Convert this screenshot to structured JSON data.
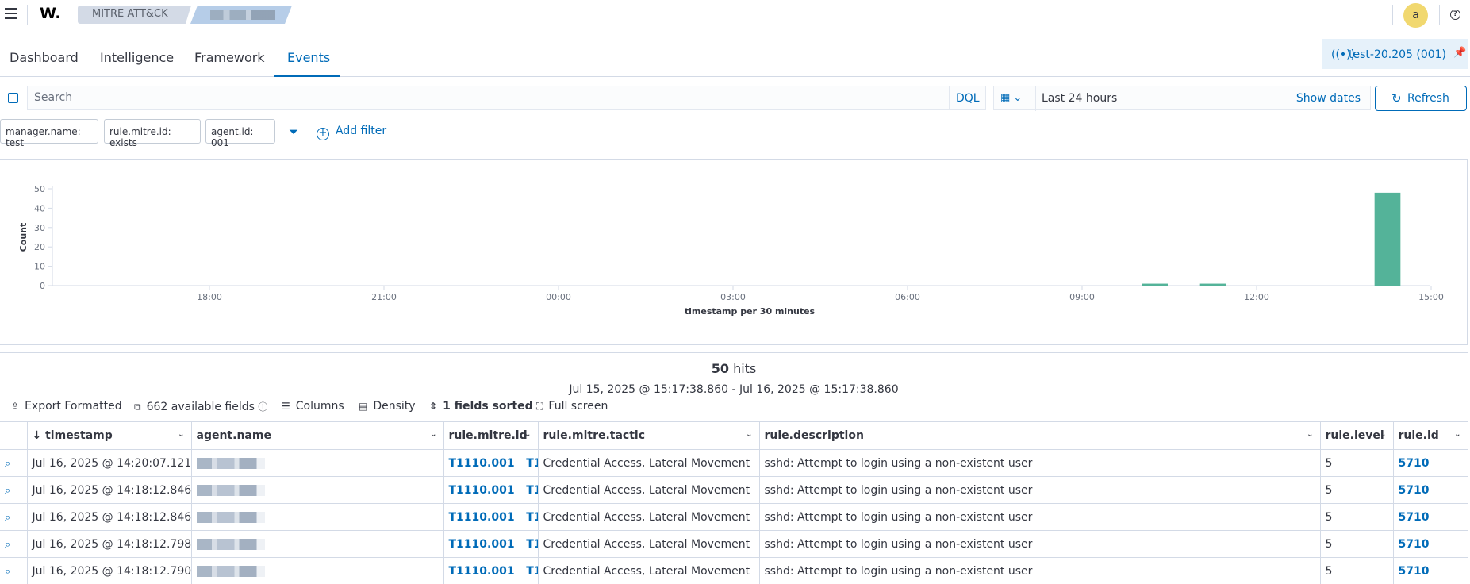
{
  "header": {
    "logo_text": "W.",
    "breadcrumb_1": "MITRE ATT&CK",
    "avatar_letter": "a",
    "help_glyph": "?"
  },
  "tabs": [
    "Dashboard",
    "Intelligence",
    "Framework",
    "Events"
  ],
  "active_tab": "Events",
  "agent_badge": "test-20.205 (001)",
  "search": {
    "placeholder": "Search",
    "language": "DQL",
    "date_range": "Last 24 hours",
    "show_dates": "Show dates",
    "refresh": "Refresh"
  },
  "filters": {
    "pills": [
      "manager.name: test",
      "rule.mitre.id: exists",
      "agent.id: 001"
    ],
    "add_filter": "Add filter"
  },
  "chart_data": {
    "type": "bar",
    "ylabel": "Count",
    "xlabel": "timestamp per 30 minutes",
    "ylim": [
      0,
      50
    ],
    "yticks": [
      0,
      10,
      20,
      30,
      40,
      50
    ],
    "xticks": [
      "18:00",
      "21:00",
      "00:00",
      "03:00",
      "06:00",
      "09:00",
      "12:00",
      "15:00"
    ],
    "bar_color": "#54b399",
    "values": [
      {
        "x": "10:00",
        "y": 1
      },
      {
        "x": "11:00",
        "y": 1
      },
      {
        "x": "14:00",
        "y": 48
      }
    ]
  },
  "results": {
    "hits_count": "50",
    "hits_label": "hits",
    "time_range": "Jul 15, 2025 @ 15:17:38.860 - Jul 16, 2025 @ 15:17:38.860",
    "toolbar": {
      "export": "Export Formatted",
      "fields": "662 available fields",
      "columns": "Columns",
      "density": "Density",
      "sorted": "1 fields sorted",
      "fullscreen": "Full screen"
    },
    "columns": [
      "timestamp",
      "agent.name",
      "rule.mitre.id",
      "rule.mitre.tactic",
      "rule.description",
      "rule.level",
      "rule.id"
    ],
    "rows": [
      {
        "timestamp": "Jul 16, 2025 @ 14:20:07.121",
        "mitre_id": "T1110.001",
        "mitre_id2": "T1",
        "tactic": "Credential Access, Lateral Movement",
        "description": "sshd: Attempt to login using a non-existent user",
        "level": "5",
        "rule_id": "5710"
      },
      {
        "timestamp": "Jul 16, 2025 @ 14:18:12.846",
        "mitre_id": "T1110.001",
        "mitre_id2": "T1",
        "tactic": "Credential Access, Lateral Movement",
        "description": "sshd: Attempt to login using a non-existent user",
        "level": "5",
        "rule_id": "5710"
      },
      {
        "timestamp": "Jul 16, 2025 @ 14:18:12.846",
        "mitre_id": "T1110.001",
        "mitre_id2": "T1",
        "tactic": "Credential Access, Lateral Movement",
        "description": "sshd: Attempt to login using a non-existent user",
        "level": "5",
        "rule_id": "5710"
      },
      {
        "timestamp": "Jul 16, 2025 @ 14:18:12.798",
        "mitre_id": "T1110.001",
        "mitre_id2": "T1",
        "tactic": "Credential Access, Lateral Movement",
        "description": "sshd: Attempt to login using a non-existent user",
        "level": "5",
        "rule_id": "5710"
      },
      {
        "timestamp": "Jul 16, 2025 @ 14:18:12.790",
        "mitre_id": "T1110.001",
        "mitre_id2": "T1",
        "tactic": "Credential Access, Lateral Movement",
        "description": "sshd: Attempt to login using a non-existent user",
        "level": "5",
        "rule_id": "5710"
      }
    ]
  }
}
